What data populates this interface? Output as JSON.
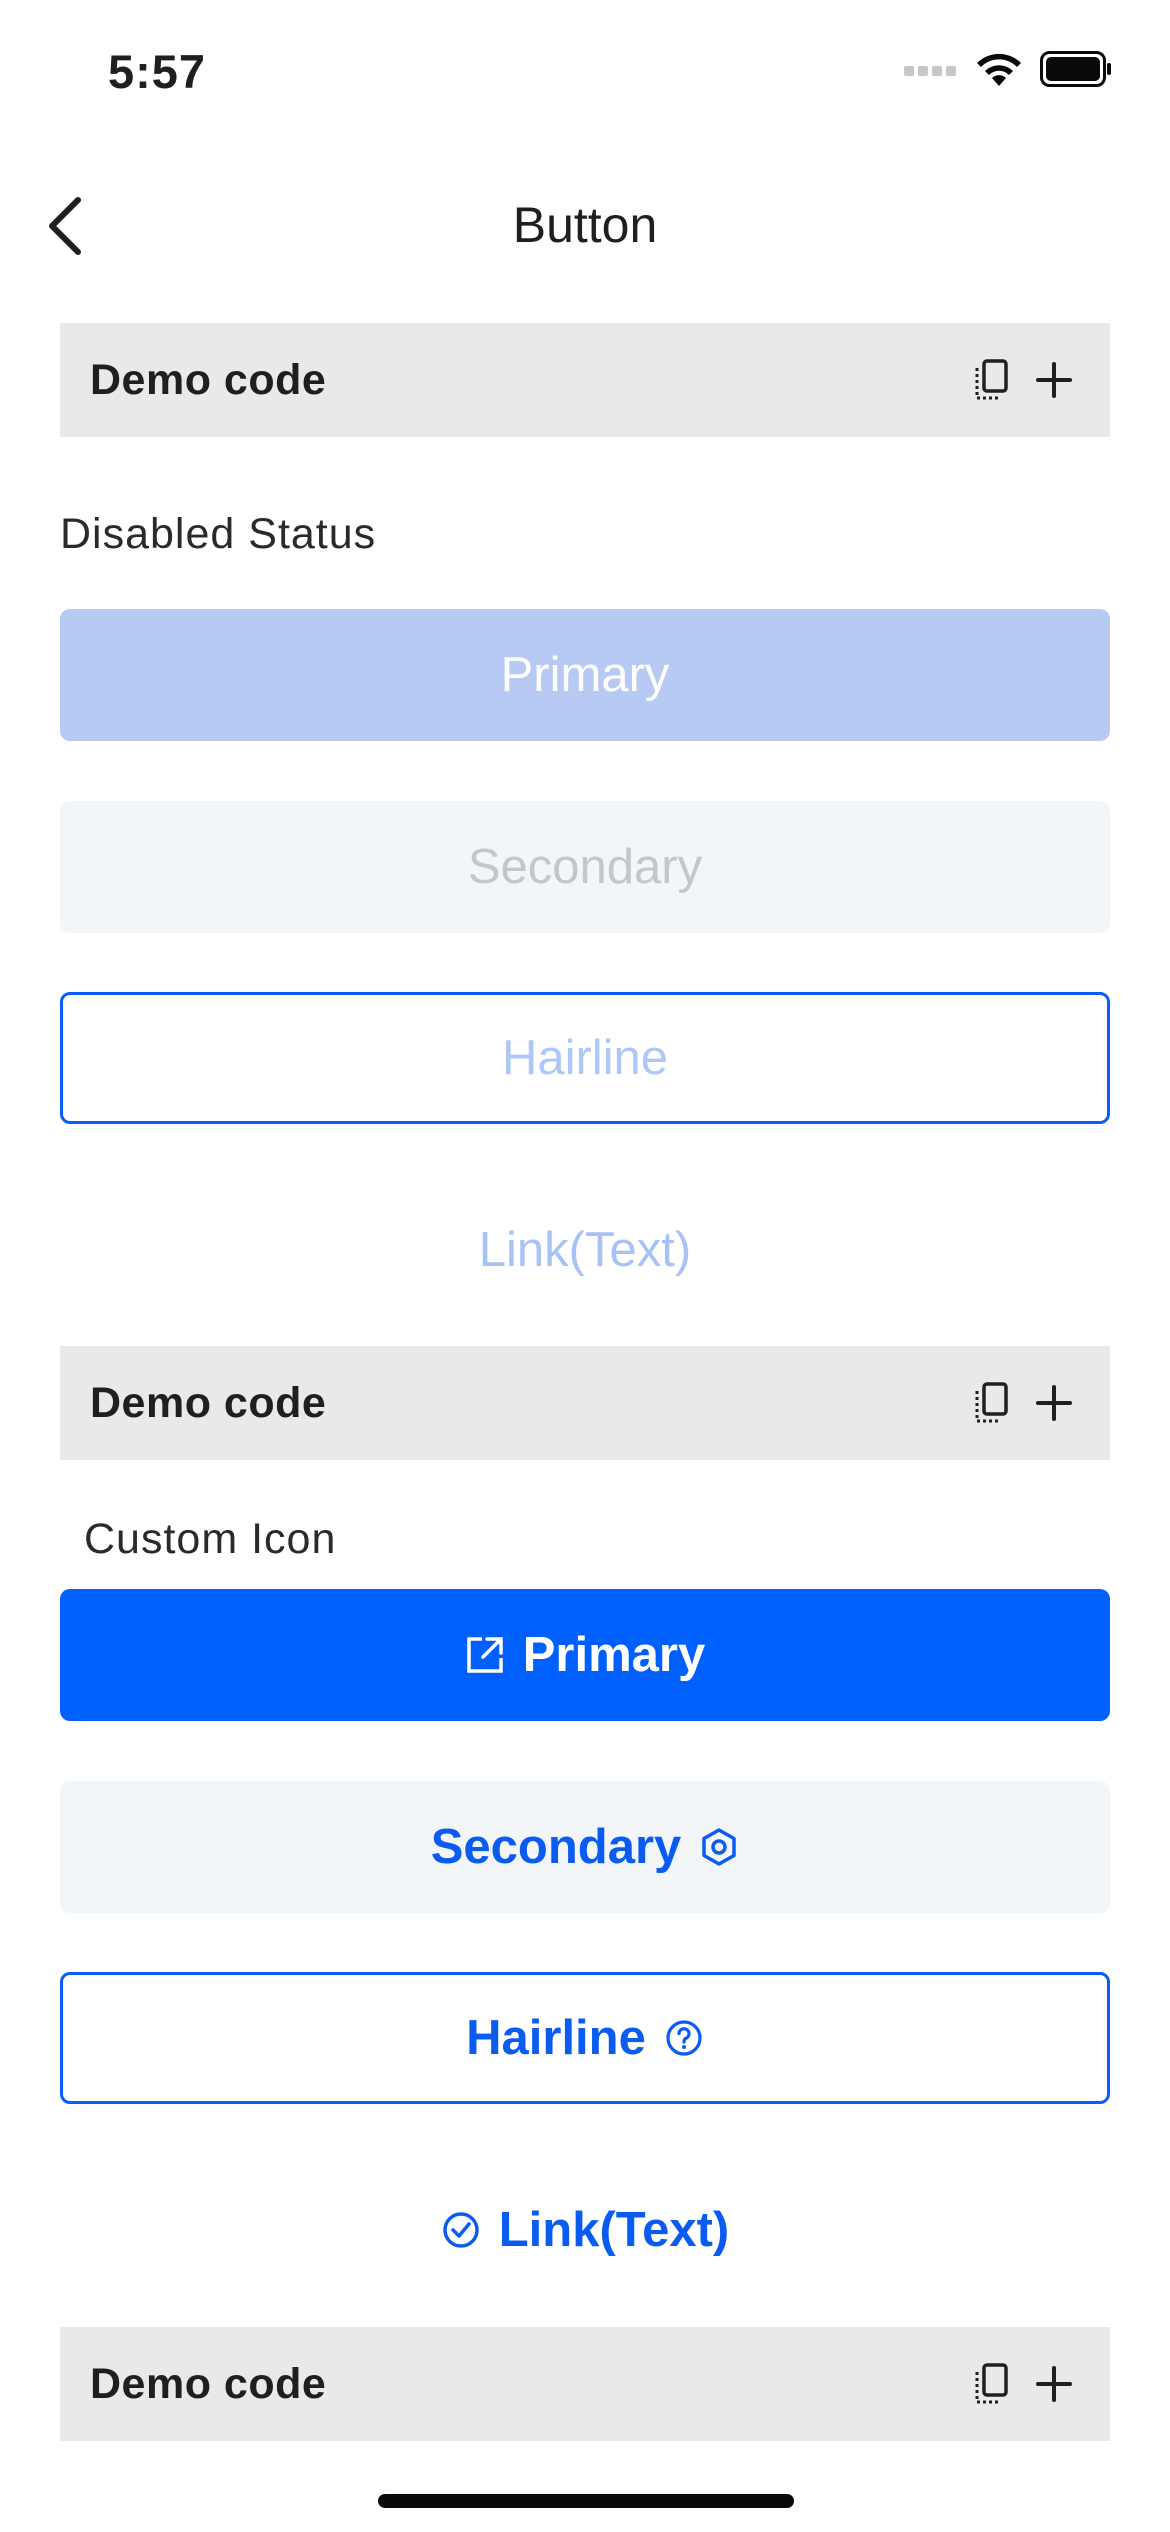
{
  "status_bar": {
    "time": "5:57"
  },
  "nav": {
    "title": "Button"
  },
  "demo_label": "Demo code",
  "disabled_section": {
    "label": "Disabled Status",
    "buttons": {
      "primary": "Primary",
      "secondary": "Secondary",
      "hairline": "Hairline",
      "link": "Link(Text)"
    }
  },
  "icon_section": {
    "label": "Custom Icon",
    "buttons": {
      "primary": "Primary",
      "secondary": "Secondary",
      "hairline": "Hairline",
      "link": "Link(Text)"
    },
    "icons": {
      "primary": "external-link-icon",
      "secondary": "settings-hexagon-icon",
      "hairline": "question-circle-icon",
      "link": "check-circle-icon"
    }
  },
  "colors": {
    "accent": "#0060fe",
    "accent_text": "#0a5cf0",
    "disabled_primary_bg": "#b7caf3",
    "secondary_bg": "#f3f6f9",
    "demo_bar_bg": "#e9e9e9"
  }
}
